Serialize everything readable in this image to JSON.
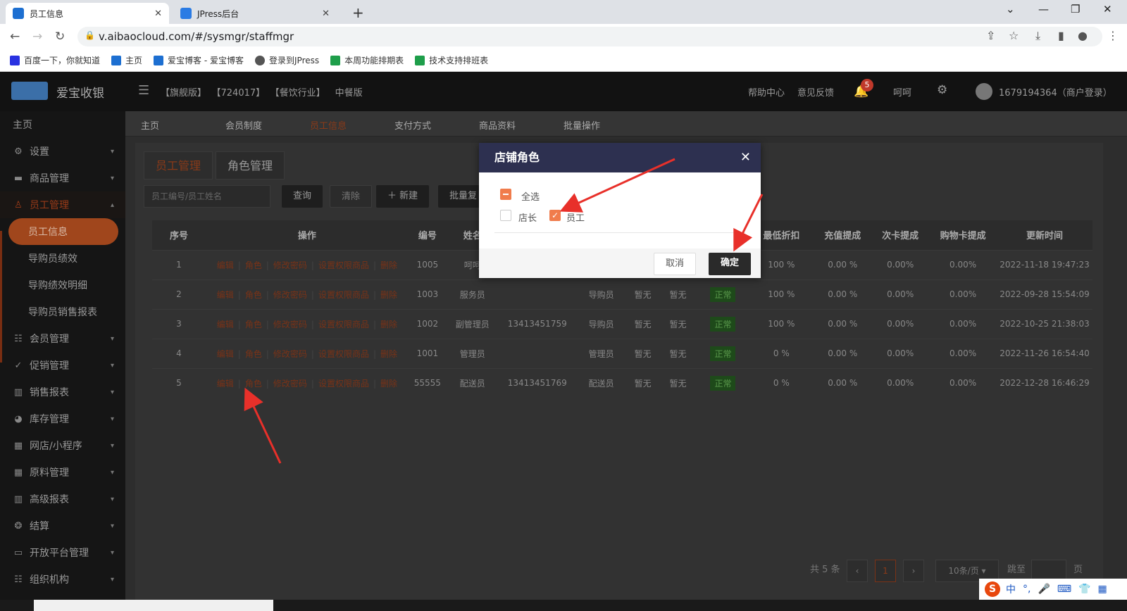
{
  "browser": {
    "tabs": [
      {
        "title": "员工信息",
        "close": "✕"
      },
      {
        "title": "JPress后台",
        "close": "✕"
      }
    ],
    "new_tab": "+",
    "url": "v.aibaocloud.com/#/sysmgr/staffmgr",
    "bookmarks": [
      "百度一下，你就知道",
      "主页",
      "爱宝博客 - 爱宝博客",
      "登录到JPress",
      "本周功能排期表",
      "技术支持排班表"
    ]
  },
  "app": {
    "brand": "爱宝收银",
    "crumbs": [
      "【旗舰版】",
      "【724017】",
      "【餐饮行业】",
      "中餐版"
    ],
    "help": "帮助中心",
    "feedback": "意见反馈",
    "notif_count": "5",
    "user_short": "呵呵",
    "account": "1679194364（商户登录）"
  },
  "sidebar": {
    "home": "主页",
    "items": [
      {
        "label": "设置",
        "icon": "gear-icon"
      },
      {
        "label": "商品管理",
        "icon": "box-icon"
      },
      {
        "label": "员工管理",
        "icon": "user-icon"
      },
      {
        "label": "会员管理",
        "icon": "member-icon"
      },
      {
        "label": "促销管理",
        "icon": "check-circle-icon"
      },
      {
        "label": "销售报表",
        "icon": "bar-chart-icon"
      },
      {
        "label": "库存管理",
        "icon": "pie-icon"
      },
      {
        "label": "网店/小程序",
        "icon": "store-icon"
      },
      {
        "label": "原料管理",
        "icon": "material-icon"
      },
      {
        "label": "高级报表",
        "icon": "chart-icon"
      },
      {
        "label": "结算",
        "icon": "settle-icon"
      },
      {
        "label": "开放平台管理",
        "icon": "monitor-icon"
      },
      {
        "label": "组织机构",
        "icon": "org-icon"
      }
    ],
    "subitems": [
      "员工信息",
      "导购员绩效",
      "导购绩效明细",
      "导购员销售报表"
    ]
  },
  "nav_tabs": [
    "主页",
    "会员制度",
    "员工信息",
    "支付方式",
    "商品资料",
    "批量操作"
  ],
  "section_tabs": [
    "员工管理",
    "角色管理"
  ],
  "toolbar": {
    "search_placeholder": "员工编号/员工姓名",
    "query": "查询",
    "clear": "清除",
    "new": "＋ 新建",
    "batch": "批量复"
  },
  "table": {
    "headers": [
      "序号",
      "操作",
      "编号",
      "姓名",
      "",
      "",
      "",
      "",
      "",
      "最低折扣",
      "充值提成",
      "次卡提成",
      "购物卡提成",
      "更新时间"
    ],
    "ops": [
      "编辑",
      "角色",
      "修改密码",
      "设置权限商品",
      "删除"
    ],
    "rows": [
      {
        "idx": "1",
        "code": "1005",
        "name": "呵呵",
        "phone": "",
        "role": "",
        "a": "",
        "b": "",
        "status": "",
        "disc": "100 %",
        "charge": "0.00 %",
        "card": "0.00%",
        "shop": "0.00%",
        "time": "2022-11-18 19:47:23"
      },
      {
        "idx": "2",
        "code": "1003",
        "name": "服务员",
        "phone": "",
        "role": "导购员",
        "a": "暂无",
        "b": "暂无",
        "status": "正常",
        "disc": "100 %",
        "charge": "0.00 %",
        "card": "0.00%",
        "shop": "0.00%",
        "time": "2022-09-28 15:54:09"
      },
      {
        "idx": "3",
        "code": "1002",
        "name": "副管理员",
        "phone": "13413451759",
        "role": "导购员",
        "a": "暂无",
        "b": "暂无",
        "status": "正常",
        "disc": "100 %",
        "charge": "0.00 %",
        "card": "0.00%",
        "shop": "0.00%",
        "time": "2022-10-25 21:38:03"
      },
      {
        "idx": "4",
        "code": "1001",
        "name": "管理员",
        "phone": "",
        "role": "管理员",
        "a": "暂无",
        "b": "暂无",
        "status": "正常",
        "disc": "0 %",
        "charge": "0.00 %",
        "card": "0.00%",
        "shop": "0.00%",
        "time": "2022-11-26 16:54:40"
      },
      {
        "idx": "5",
        "code": "55555",
        "name": "配送员",
        "phone": "13413451769",
        "role": "配送员",
        "a": "暂无",
        "b": "暂无",
        "status": "正常",
        "disc": "0 %",
        "charge": "0.00 %",
        "card": "0.00%",
        "shop": "0.00%",
        "time": "2022-12-28 16:46:29"
      }
    ]
  },
  "pager": {
    "total": "共 5 条",
    "page": "1",
    "page_size": "10条/页",
    "goto": "跳至",
    "page_unit": "页"
  },
  "modal": {
    "title": "店铺角色",
    "close": "✕",
    "select_all": "全选",
    "options": [
      {
        "label": "店长",
        "checked": false
      },
      {
        "label": "员工",
        "checked": true
      }
    ],
    "cancel": "取消",
    "confirm": "确定"
  },
  "ime": {
    "label": "中"
  },
  "colors": {
    "accent": "#f07c4c",
    "modal_header": "#2d3050",
    "annotation": "#e8302a"
  }
}
